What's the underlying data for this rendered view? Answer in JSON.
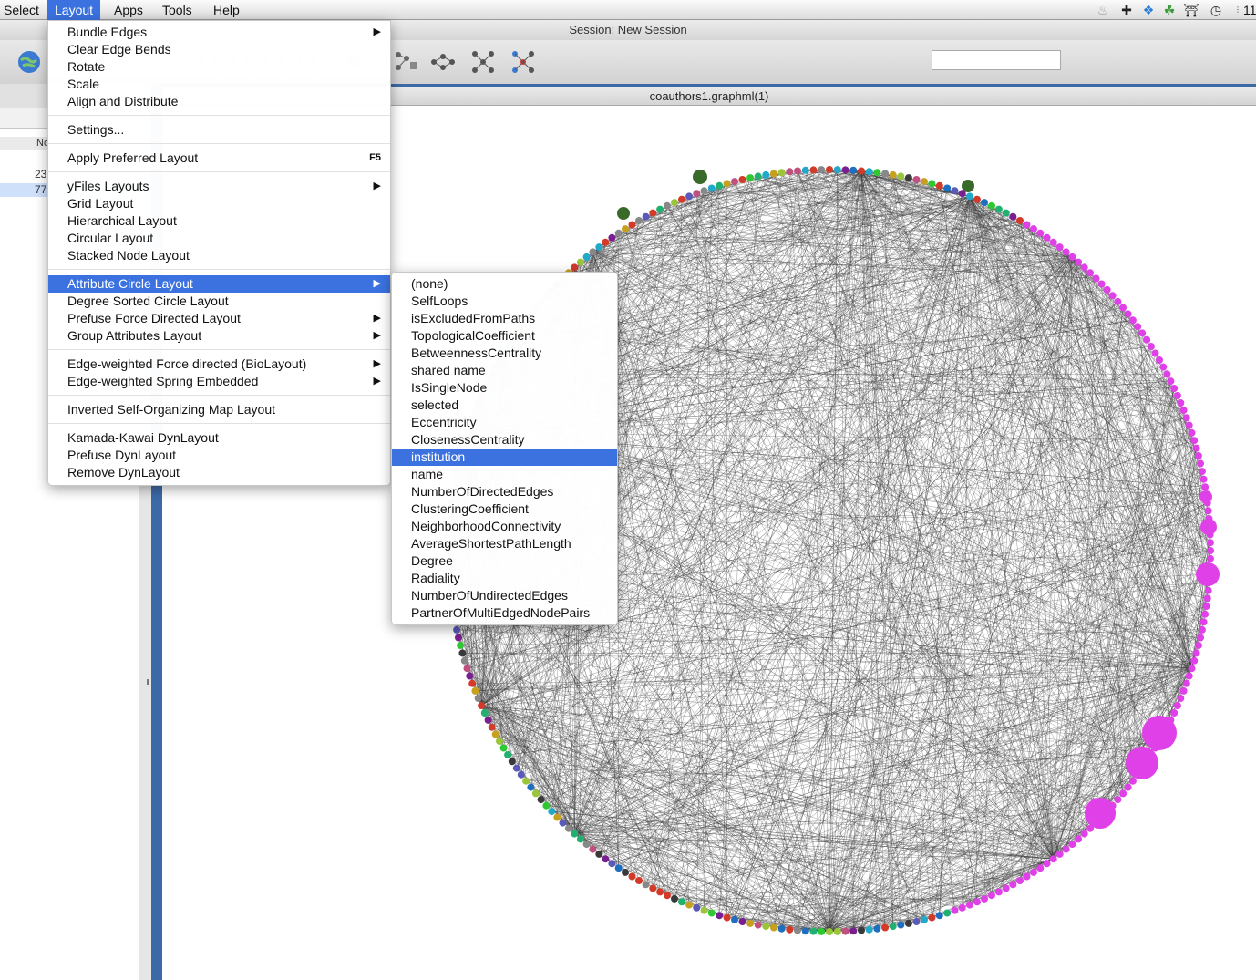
{
  "menubar": {
    "items": [
      "Select",
      "Layout",
      "Apps",
      "Tools",
      "Help"
    ],
    "active": "Layout",
    "tray_icons": [
      "bell-icon",
      "plus-cross-icon",
      "dropbox-icon",
      "evernote-icon",
      "bank-icon",
      "timer-icon",
      "pause-icon"
    ],
    "clock": "11"
  },
  "window": {
    "title": "Session: New Session"
  },
  "view": {
    "title": "coauthors1.graphml(1)"
  },
  "left_panel": {
    "column_header": "No",
    "numbers": [
      "23",
      "77"
    ]
  },
  "layout_menu": {
    "items": [
      {
        "label": "Bundle Edges",
        "arrow": true
      },
      {
        "label": "Clear Edge Bends"
      },
      {
        "label": "Rotate"
      },
      {
        "label": "Scale"
      },
      {
        "label": "Align and Distribute"
      },
      {
        "sep": true
      },
      {
        "label": "Settings..."
      },
      {
        "sep": true
      },
      {
        "label": "Apply Preferred Layout",
        "shortcut": "F5"
      },
      {
        "sep": true
      },
      {
        "label": "yFiles Layouts",
        "arrow": true
      },
      {
        "label": "Grid Layout"
      },
      {
        "label": "Hierarchical Layout"
      },
      {
        "label": "Circular Layout"
      },
      {
        "label": "Stacked Node Layout"
      },
      {
        "sep": true
      },
      {
        "label": "Attribute Circle Layout",
        "arrow": true,
        "highlight": true
      },
      {
        "label": "Degree Sorted Circle Layout"
      },
      {
        "label": "Prefuse Force Directed Layout",
        "arrow": true
      },
      {
        "label": "Group Attributes Layout",
        "arrow": true
      },
      {
        "sep": true
      },
      {
        "label": "Edge-weighted Force directed (BioLayout)",
        "arrow": true
      },
      {
        "label": "Edge-weighted Spring Embedded",
        "arrow": true
      },
      {
        "sep": true
      },
      {
        "label": "Inverted Self-Organizing Map Layout"
      },
      {
        "sep": true
      },
      {
        "label": "Kamada-Kawai DynLayout"
      },
      {
        "label": "Prefuse DynLayout"
      },
      {
        "label": "Remove DynLayout"
      }
    ]
  },
  "attribute_menu": {
    "items": [
      "(none)",
      "SelfLoops",
      "isExcludedFromPaths",
      "TopologicalCoefficient",
      "BetweennessCentrality",
      "shared name",
      "IsSingleNode",
      "selected",
      "Eccentricity",
      "ClosenessCentrality",
      "institution",
      "name",
      "NumberOfDirectedEdges",
      "ClusteringCoefficient",
      "NeighborhoodConnectivity",
      "AverageShortestPathLength",
      "Degree",
      "Radiality",
      "NumberOfUndirectedEdges",
      "PartnerOfMultiEdgedNodePairs"
    ],
    "highlighted": "institution"
  },
  "colors": {
    "menu_highlight": "#3b72e0",
    "edge": "#3a3a3a",
    "magenta_nodes": "#e040e8",
    "panel_blue": "#3d6aa6"
  }
}
